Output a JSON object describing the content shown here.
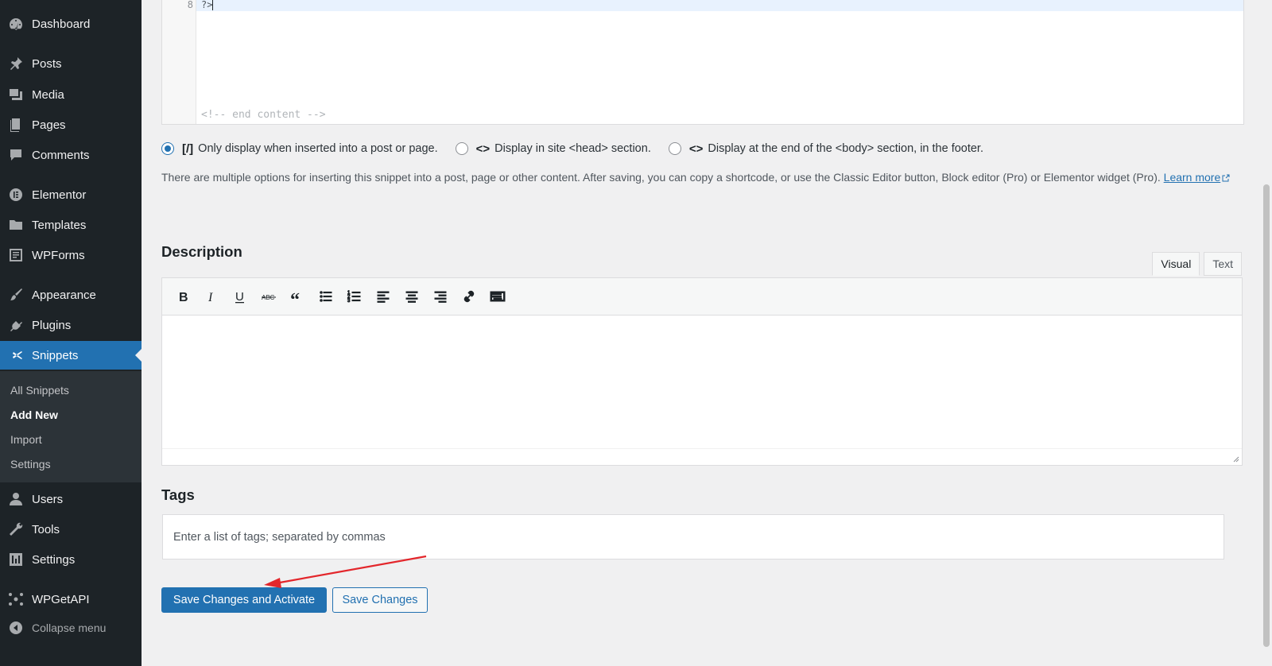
{
  "sidebar": {
    "items": [
      {
        "label": "Dashboard",
        "icon": "dashboard-icon"
      },
      {
        "label": "Posts",
        "icon": "pushpin-icon"
      },
      {
        "label": "Media",
        "icon": "media-icon"
      },
      {
        "label": "Pages",
        "icon": "pages-icon"
      },
      {
        "label": "Comments",
        "icon": "comments-icon"
      },
      {
        "label": "Elementor",
        "icon": "elementor-icon"
      },
      {
        "label": "Templates",
        "icon": "folder-icon"
      },
      {
        "label": "WPForms",
        "icon": "wpforms-icon"
      },
      {
        "label": "Appearance",
        "icon": "paintbrush-icon"
      },
      {
        "label": "Plugins",
        "icon": "plugin-icon"
      },
      {
        "label": "Snippets",
        "icon": "scissors-icon"
      },
      {
        "label": "Users",
        "icon": "user-icon"
      },
      {
        "label": "Tools",
        "icon": "wrench-icon"
      },
      {
        "label": "Settings",
        "icon": "settings-icon"
      },
      {
        "label": "WPGetAPI",
        "icon": "network-icon"
      },
      {
        "label": "Collapse menu",
        "icon": "collapse-icon"
      }
    ],
    "submenu": [
      "All Snippets",
      "Add New",
      "Import",
      "Settings"
    ],
    "current": "Snippets",
    "active_sub": "Add New"
  },
  "code_editor": {
    "line_number": "8",
    "line_text": "?>",
    "end_comment": "<!-- end content -->"
  },
  "location": {
    "options": [
      {
        "icon": "[/]",
        "label": "Only display when inserted into a post or page.",
        "checked": true
      },
      {
        "icon": "<>",
        "label": "Display in site <head> section.",
        "checked": false
      },
      {
        "icon": "<>",
        "label": "Display at the end of the <body> section, in the footer.",
        "checked": false
      }
    ]
  },
  "help": {
    "text": "There are multiple options for inserting this snippet into a post, page or other content. After saving, you can copy a shortcode, or use the Classic Editor button, Block editor (Pro) or Elementor widget (Pro).",
    "link": "Learn more"
  },
  "description": {
    "title": "Description",
    "tab_visual": "Visual",
    "tab_text": "Text",
    "toolbar": [
      "bold-icon",
      "italic-icon",
      "underline-icon",
      "strikethrough-icon",
      "blockquote-icon",
      "bullet-list-icon",
      "numbered-list-icon",
      "align-left-icon",
      "align-center-icon",
      "align-right-icon",
      "link-icon",
      "toolbar-toggle-icon"
    ]
  },
  "tags": {
    "title": "Tags",
    "placeholder": "Enter a list of tags; separated by commas"
  },
  "actions": {
    "primary": "Save Changes and Activate",
    "secondary": "Save Changes"
  },
  "colors": {
    "sidebar_bg": "#1d2327",
    "accent": "#2271b1",
    "annotation_arrow": "#e3262b"
  }
}
